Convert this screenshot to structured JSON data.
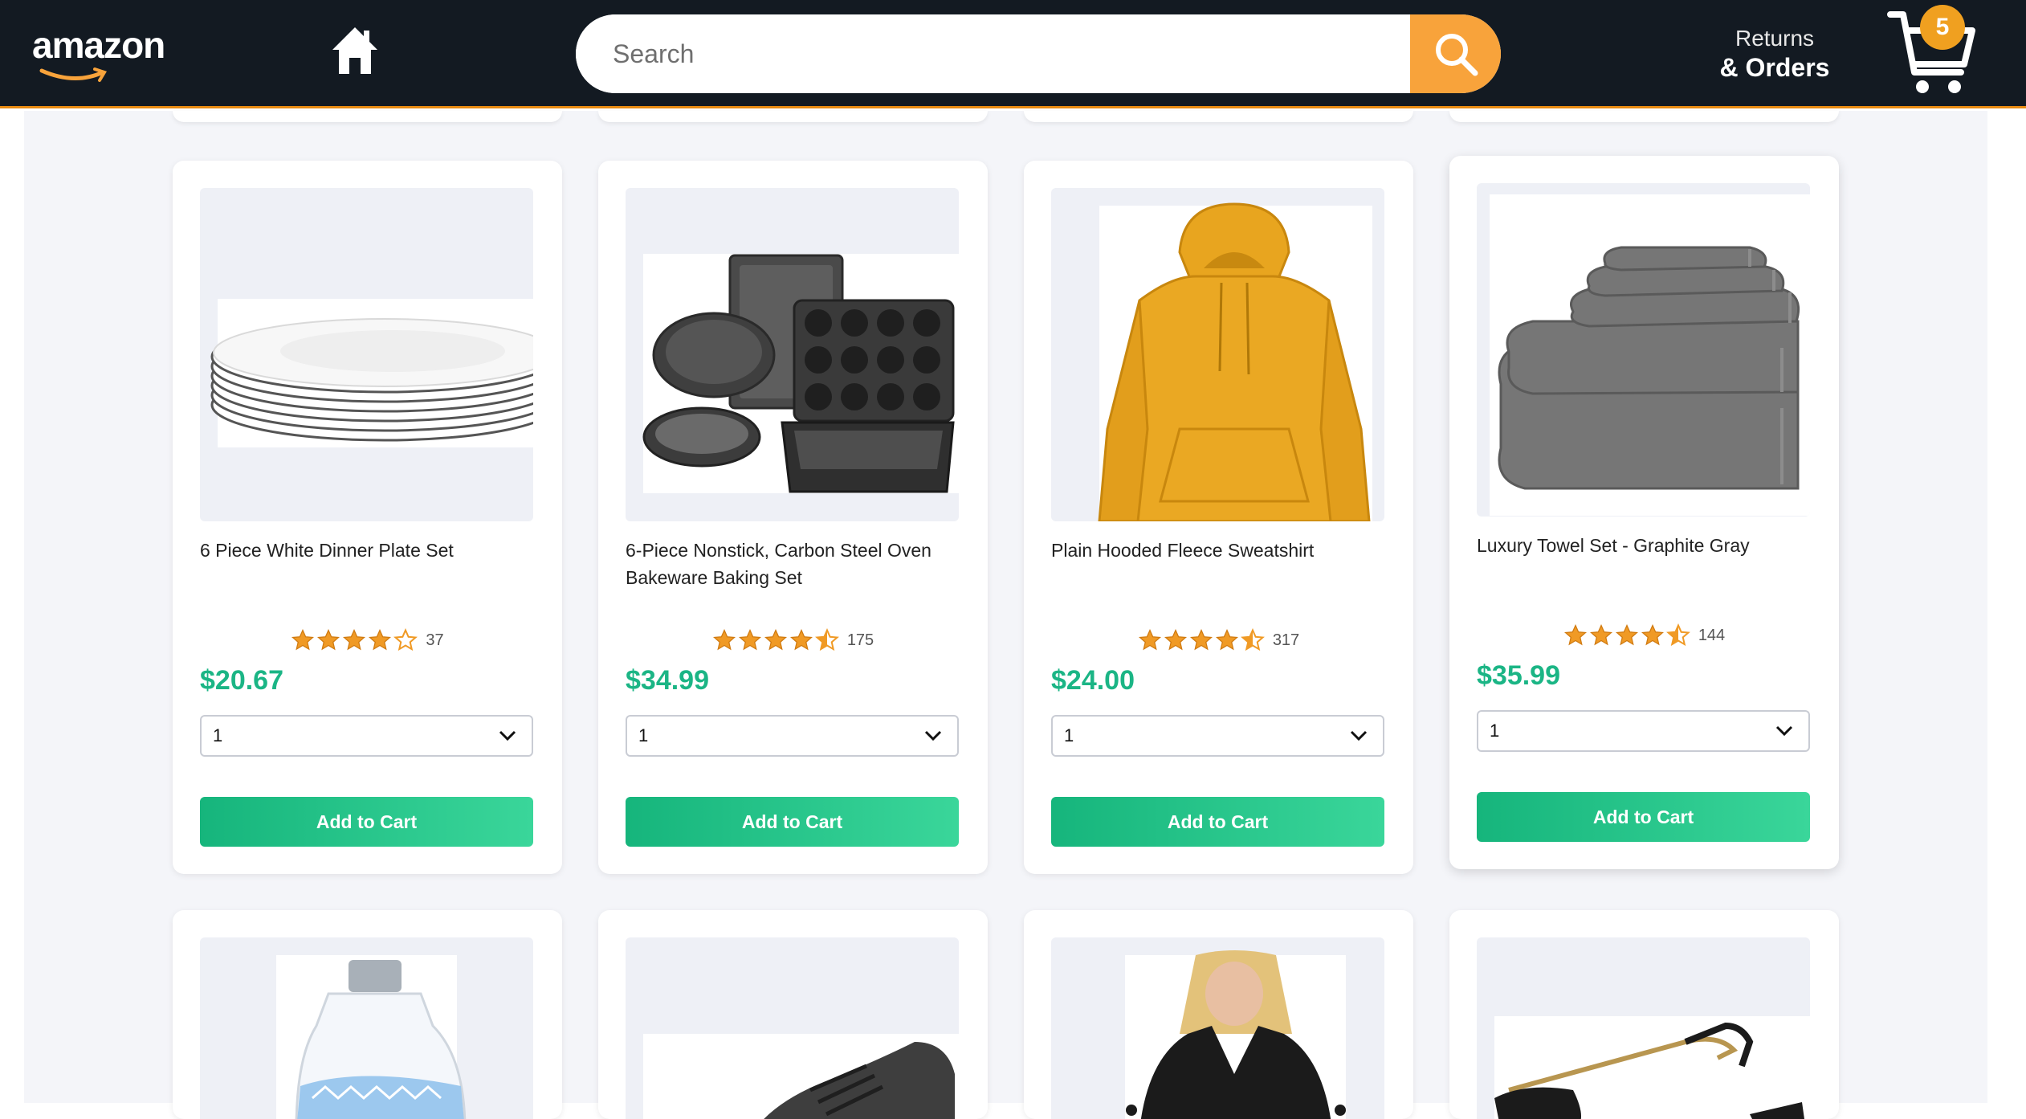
{
  "header": {
    "logo_text": "amazon",
    "search_placeholder": "Search",
    "returns_small": "Returns",
    "returns_big": "& Orders",
    "cart_count": "5",
    "icons": [
      "home-icon",
      "search-icon",
      "cart-icon"
    ]
  },
  "colors": {
    "header_bg": "#131a22",
    "accent": "#f8a33b",
    "price": "#1bb585",
    "button": "#16b57c",
    "star": "#f09a25"
  },
  "products": [
    {
      "title": "6 Piece White Dinner Plate Set",
      "rating": 4,
      "rating_count": "37",
      "price": "$20.67",
      "qty": "1",
      "button": "Add to Cart"
    },
    {
      "title": "6-Piece Nonstick, Carbon Steel Oven Bakeware Baking Set",
      "rating": 4.5,
      "rating_count": "175",
      "price": "$34.99",
      "qty": "1",
      "button": "Add to Cart"
    },
    {
      "title": "Plain Hooded Fleece Sweatshirt",
      "rating": 4.5,
      "rating_count": "317",
      "price": "$24.00",
      "qty": "1",
      "button": "Add to Cart"
    },
    {
      "title": "Luxury Towel Set - Graphite Gray",
      "rating": 4.5,
      "rating_count": "144",
      "price": "$35.99",
      "qty": "1",
      "button": "Add to Cart"
    }
  ]
}
